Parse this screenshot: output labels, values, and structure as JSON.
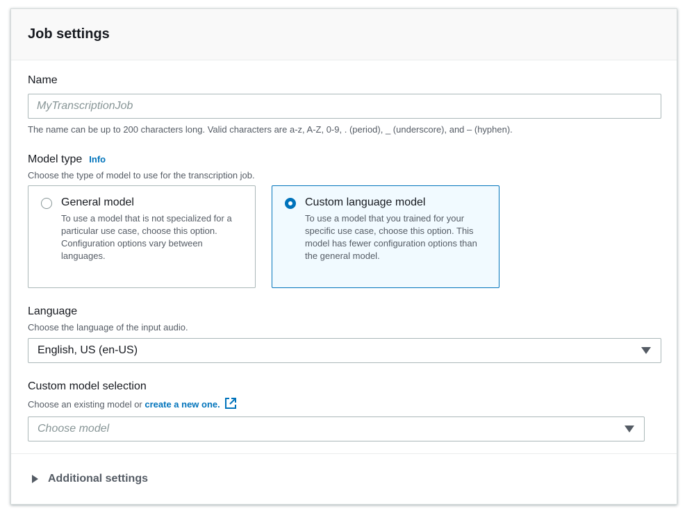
{
  "header": {
    "title": "Job settings"
  },
  "name_field": {
    "label": "Name",
    "placeholder": "MyTranscriptionJob",
    "value": "",
    "constraint": "The name can be up to 200 characters long. Valid characters are a-z, A-Z, 0-9, . (period), _ (underscore), and – (hyphen)."
  },
  "model_type": {
    "label": "Model type",
    "info_link": "Info",
    "description": "Choose the type of model to use for the transcription job.",
    "options": [
      {
        "title": "General model",
        "description": "To use a model that is not specialized for a particular use case, choose this option. Configuration options vary between languages.",
        "selected": false
      },
      {
        "title": "Custom language model",
        "description": "To use a model that you trained for your specific use case, choose this option. This model has fewer configuration options than the general model.",
        "selected": true
      }
    ]
  },
  "language": {
    "label": "Language",
    "description": "Choose the language of the input audio.",
    "selected": "English, US (en-US)"
  },
  "custom_model": {
    "label": "Custom model selection",
    "description_prefix": "Choose an existing model or ",
    "create_link": "create a new one.",
    "placeholder": "Choose model"
  },
  "additional_settings": {
    "label": "Additional settings",
    "expanded": false
  },
  "colors": {
    "accent": "#0073bb",
    "selected_tile_bg": "#f1faff",
    "text": "#16191f",
    "secondary_text": "#545b64",
    "border": "#aab7b8"
  }
}
